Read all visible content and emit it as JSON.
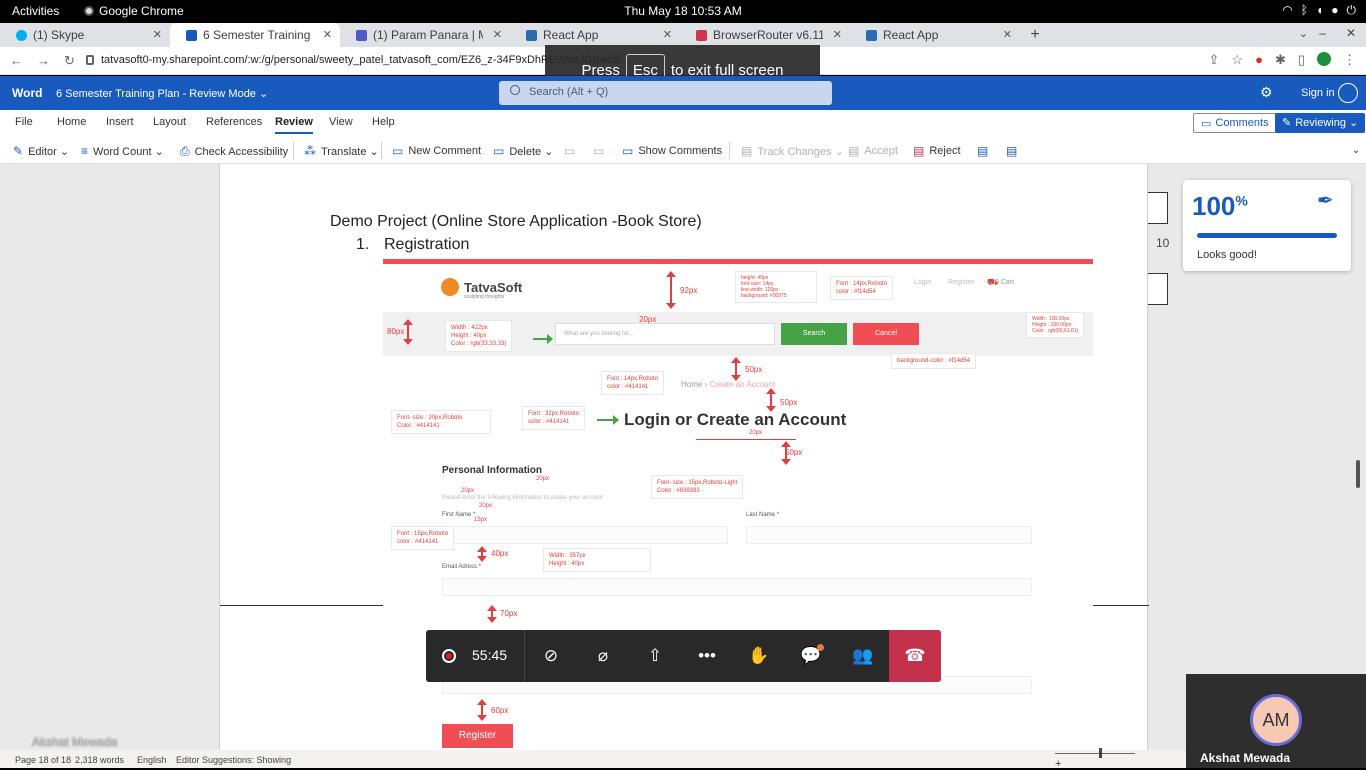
{
  "system": {
    "activities": "Activities",
    "app": "Google Chrome",
    "clock": "Thu May 18  10:53 AM"
  },
  "tabs": [
    {
      "title": "(1) Skype",
      "color": "#00aff0"
    },
    {
      "title": "6 Semester Training Plan",
      "color": "#185abd"
    },
    {
      "title": "(1) Param Panara | Micros",
      "color": "#5059c9"
    },
    {
      "title": "React App",
      "color": "#2b6cb0"
    },
    {
      "title": "BrowserRouter v6.11.2 | R",
      "color": "#d0344a"
    },
    {
      "title": "React App",
      "color": "#2b6cb0"
    }
  ],
  "addressbar": {
    "url": "tatvasoft0-my.sharepoint.com/:w:/g/personal/sweety_patel_tatvasoft_com/EZ6_z-34F9xDhREWbnJDBwsB..."
  },
  "fullscreen_toast": {
    "press": "Press",
    "key": "Esc",
    "rest": "to exit full screen"
  },
  "word": {
    "brand": "Word",
    "doc_title": "6 Semester Training Plan  -  Review Mode ⌄",
    "search_placeholder": "Search (Alt + Q)",
    "signin": "Sign in"
  },
  "menu": {
    "items": [
      "File",
      "Home",
      "Insert",
      "Layout",
      "References",
      "Review",
      "View",
      "Help"
    ],
    "comments_btn": "Comments",
    "reviewing_btn": "Reviewing ⌄"
  },
  "ribbon": {
    "editor": "Editor ⌄",
    "word_count": "Word Count ⌄",
    "check_accessibility": "Check Accessibility",
    "translate": "Translate ⌄",
    "new_comment": "New Comment",
    "delete": "Delete ⌄",
    "show_comments": "Show Comments",
    "track_changes": "Track Changes ⌄",
    "accept": "Accept",
    "reject": "Reject"
  },
  "document": {
    "heading": "Demo Project (Online Store Application -Book Store)",
    "list_num": "1.",
    "list_item": "Registration"
  },
  "mockup": {
    "logo_text": "TatvaSoft",
    "logo_sub": "sculpting thoughts",
    "search_placeholder": "What are you looking for...",
    "search_btn": "Search",
    "cancel_btn": "Cancel",
    "nav_login": "Login",
    "nav_register": "Register",
    "nav_cart": "0 Cart",
    "crumb_home": "Home",
    "crumb_current": "Create an Account",
    "big_title": "Login or Create an Account",
    "personal_info": "Personal Information",
    "personal_desc": "Please enter the following information to create your account",
    "first_name": "First Name *",
    "last_name": "Last Name *",
    "email": "Email Adress *",
    "register_btn": "Register",
    "notes": {
      "header_size": "height: 40px\nfont-size: 14px\nline-width: 120px\nbackground: #00975",
      "nav_font": "Font : 14px,Roboto\ncolor : #f14d54",
      "search_size": "Width : 422px\nHeight : 40px\nColor : rgb(33,33,33)",
      "right_size": "Width : 100.00px\nHeight : 100.00px\nColor : rgb(65,61,61)",
      "bg_color": "background-color : #f14d54",
      "crumb_font": "Font : 14px,Roboto\ncolor : #414141",
      "body_font": "Font- size : 20px,Roboto\nColor : #414141",
      "title_font": "Font : 32px,Roboto\ncolor : #414141",
      "light_font": "Font- size : 15px,Roboto-Light\nColor : #838383",
      "label_font": "Font : 15px,Roboto\ncolor : #414141",
      "field_size": "Width : 357px\nHeight : 40px"
    },
    "dims": {
      "d92": "92px",
      "d80": "80px",
      "d20a": "20px",
      "d50a": "50px",
      "d50b": "50px",
      "d20b": "20px",
      "d50c": "50px",
      "d20c": "20px",
      "d20d": "20px",
      "d20e": "20px",
      "d15": "15px",
      "d40": "40px",
      "d70": "70px",
      "d60": "60px"
    }
  },
  "ruler_number": "10",
  "editor_card": {
    "percent": "100",
    "percent_sign": "%",
    "status": "Looks good!"
  },
  "call": {
    "timer": "55:45"
  },
  "status": {
    "page": "Page 18 of 18",
    "words": "2,318 words",
    "language": "English",
    "suggestions": "Editor Suggestions: Showing"
  },
  "presenter": "Akshat Mewada",
  "participant": {
    "initials": "AM",
    "name": "Akshat Mewada"
  }
}
